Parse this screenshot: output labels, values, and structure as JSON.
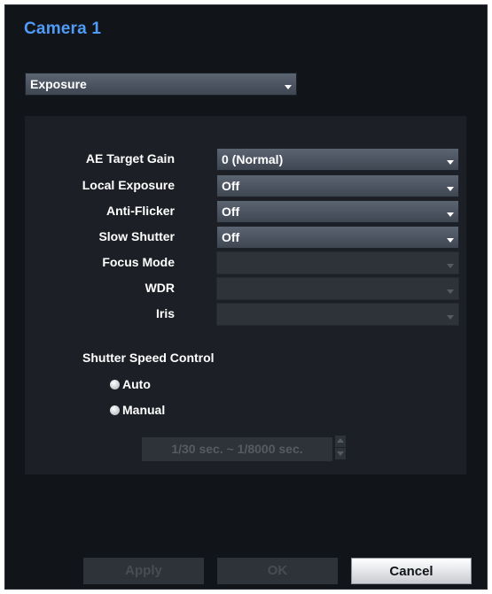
{
  "window": {
    "title": "Camera 1"
  },
  "category": {
    "selected": "Exposure"
  },
  "settings": {
    "ae_target_gain": {
      "label": "AE Target Gain",
      "value": "0 (Normal)"
    },
    "local_exposure": {
      "label": "Local Exposure",
      "value": "Off"
    },
    "anti_flicker": {
      "label": "Anti-Flicker",
      "value": "Off"
    },
    "slow_shutter": {
      "label": "Slow Shutter",
      "value": "Off"
    },
    "focus_mode": {
      "label": "Focus Mode",
      "value": ""
    },
    "wdr": {
      "label": "WDR",
      "value": ""
    },
    "iris": {
      "label": "Iris",
      "value": ""
    }
  },
  "shutter": {
    "title": "Shutter Speed Control",
    "auto_label": "Auto",
    "manual_label": "Manual",
    "range": "1/30 sec. ~ 1/8000 sec."
  },
  "buttons": {
    "apply": "Apply",
    "ok": "OK",
    "cancel": "Cancel"
  },
  "colors": {
    "accent": "#4f9bf5",
    "background": "#111419",
    "panel": "#1c2026"
  }
}
